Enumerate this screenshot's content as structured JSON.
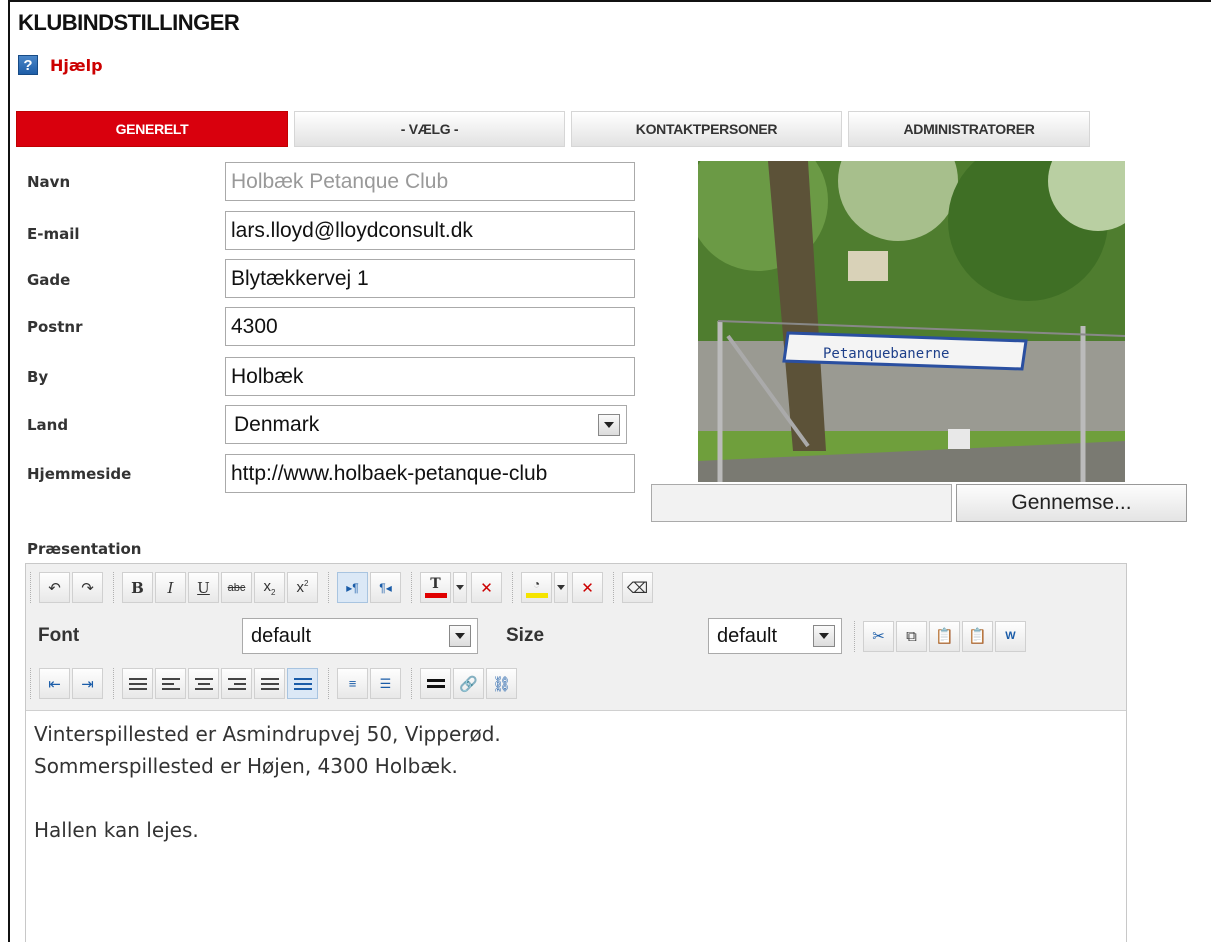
{
  "page": {
    "title": "KLUBINDSTILLINGER",
    "help_label": "Hjælp"
  },
  "tabs": [
    {
      "label": "GENERELT",
      "active": true
    },
    {
      "label": "- VÆLG -",
      "active": false
    },
    {
      "label": "KONTAKTPERSONER",
      "active": false
    },
    {
      "label": "ADMINISTRATORER",
      "active": false
    }
  ],
  "form": {
    "name_label": "Navn",
    "name_value": "Holbæk Petanque Club",
    "email_label": "E-mail",
    "email_value": "lars.lloyd@lloydconsult.dk",
    "street_label": "Gade",
    "street_value": "Blytækkervej 1",
    "zip_label": "Postnr",
    "zip_value": "4300",
    "city_label": "By",
    "city_value": "Holbæk",
    "country_label": "Land",
    "country_value": "Denmark",
    "website_label": "Hjemmeside",
    "website_value": "http://www.holbaek-petanque-club"
  },
  "photo": {
    "sign_text": "Petanquebanerne",
    "browse_label": "Gennemse..."
  },
  "editor": {
    "section_label": "Præsentation",
    "font_label": "Font",
    "font_value": "default",
    "size_label": "Size",
    "size_value": "default",
    "content": "Vinterspillested er Asmindrupvej 50, Vipperød.\nSommerspillested er Højen, 4300 Holbæk.\n\nHallen kan lejes."
  },
  "colors": {
    "accent": "#d9000d",
    "help_text": "#cc0000",
    "text_color_bar": "#e00000",
    "highlight_bar": "#f5e400"
  }
}
